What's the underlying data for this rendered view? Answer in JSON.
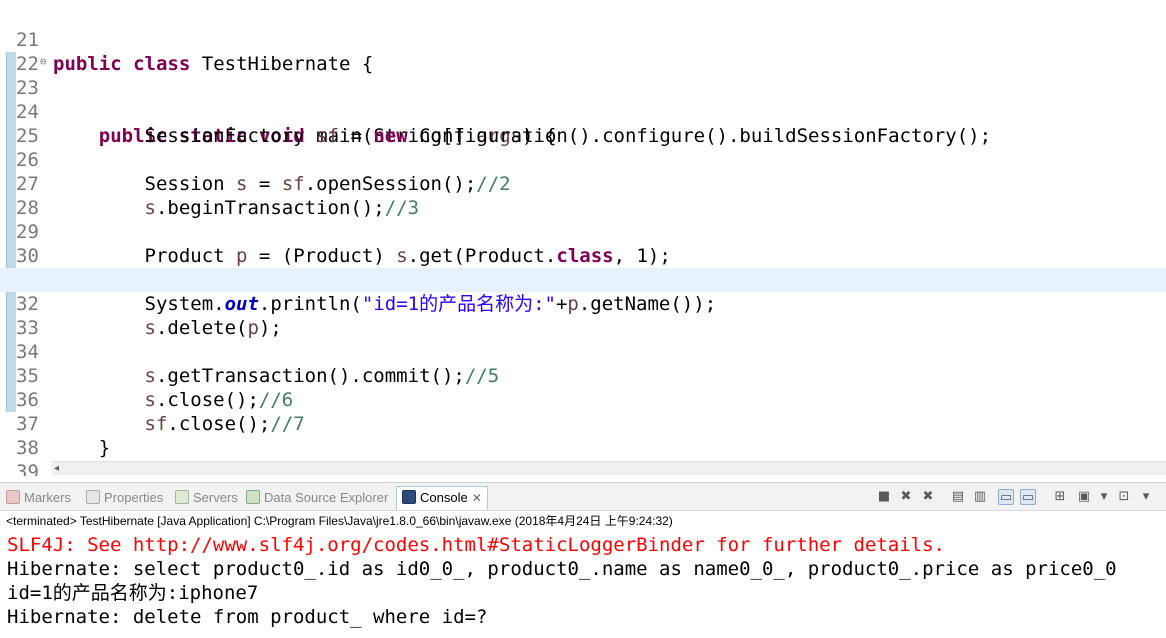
{
  "editor": {
    "lines": [
      {
        "n": "21",
        "html": "<span class=\"kw\">public</span> <span class=\"kw\">class</span> <span data-b=\"0\"></span> {",
        "segs": [
          "TestHibernate"
        ]
      },
      {
        "n": "22",
        "code": ""
      },
      {
        "n": "23",
        "fold": true
      },
      {
        "n": "24"
      },
      {
        "n": "25"
      },
      {
        "n": "26"
      },
      {
        "n": "27"
      },
      {
        "n": "28"
      },
      {
        "n": "29"
      },
      {
        "n": "30"
      },
      {
        "n": "31"
      },
      {
        "n": "32",
        "current": true
      },
      {
        "n": "33"
      },
      {
        "n": "34"
      },
      {
        "n": "35"
      },
      {
        "n": "36"
      },
      {
        "n": "37"
      },
      {
        "n": "38"
      },
      {
        "n": "39"
      }
    ],
    "tokens": {
      "l21": [
        "public",
        "class",
        "TestHibernate {"
      ],
      "l23": [
        "public",
        "static",
        "void",
        "main(String[] ",
        "args",
        ") {"
      ],
      "l24": [
        "SessionFactory ",
        "sf",
        " = ",
        "new",
        " Configuration().configure().buildSessionFactory();"
      ],
      "l26": [
        "Session ",
        "s",
        " = ",
        "sf",
        ".openSession();",
        "//2"
      ],
      "l27": [
        "s",
        ".beginTransaction();",
        "//3"
      ],
      "l29": [
        "Product ",
        "p",
        " = (Product) ",
        "s",
        ".get(Product.",
        "class",
        ", 1);"
      ],
      "l31": [
        "System.",
        "out",
        ".println(",
        "\"id=1的产品名称为:\"",
        "+",
        "p",
        ".getName());"
      ],
      "l32": [
        "s",
        ".delete(",
        "p",
        ");"
      ],
      "l34": [
        "s",
        ".getTransaction().commit();",
        "//5"
      ],
      "l35": [
        "s",
        ".close();",
        "//6"
      ],
      "l36": [
        "sf",
        ".close();",
        "//7"
      ],
      "l37": [
        "}"
      ],
      "l39": [
        "}"
      ]
    }
  },
  "console": {
    "tabs": [
      "Markers",
      "Properties",
      "Servers",
      "Data Source Explorer",
      "Console"
    ],
    "process": "<terminated> TestHibernate [Java Application] C:\\Program Files\\Java\\jre1.8.0_66\\bin\\javaw.exe (2018年4月24日 上午9:24:32)",
    "output": [
      "SLF4J: See http://www.slf4j.org/codes.html#StaticLoggerBinder for further details.",
      "Hibernate: select product0_.id as id0_0_, product0_.name as name0_0_, product0_.price as price0_0",
      "id=1的产品名称为:iphone7",
      "Hibernate: delete from product_ where id=?"
    ],
    "colors": {
      "error": "#ff0000",
      "stdout": "#000000"
    }
  }
}
